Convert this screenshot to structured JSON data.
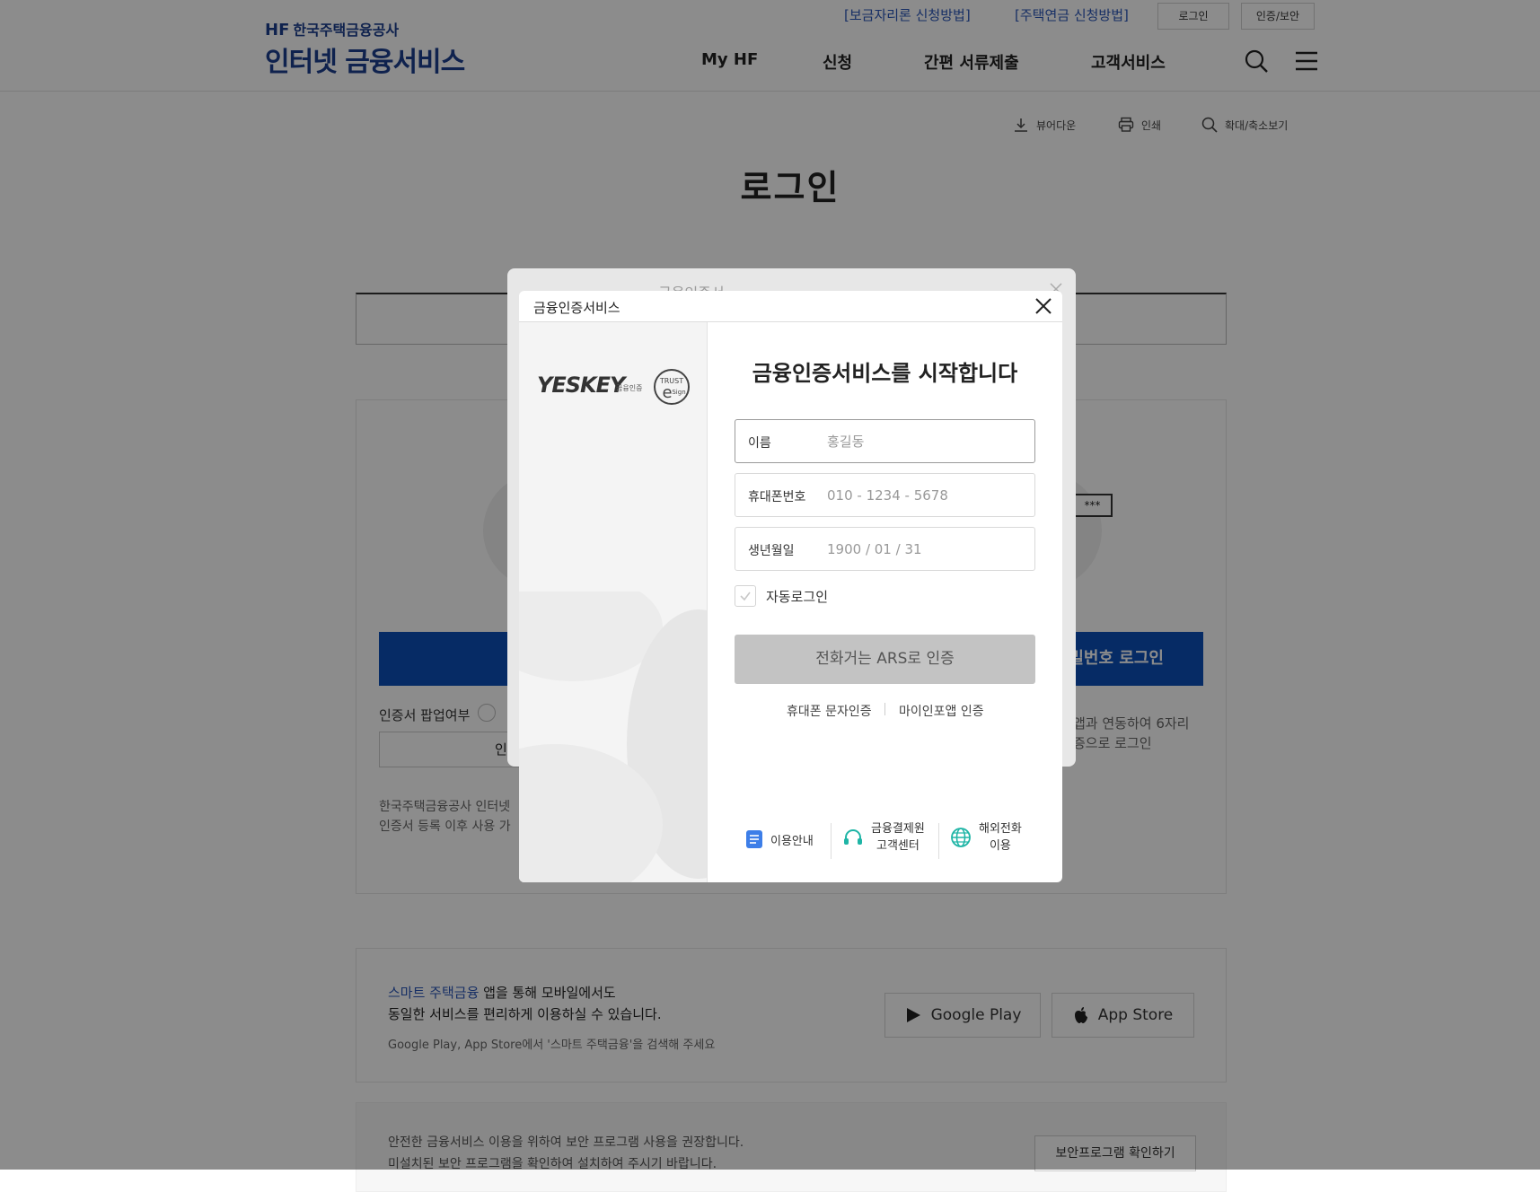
{
  "header": {
    "brand_small_prefix": "HF",
    "brand_small": "한국주택금융공사",
    "brand_main": "인터넷 금융서비스",
    "util_links": [
      "[보금자리론 신청방법]",
      "[주택연금 신청방법]"
    ],
    "util_buttons": [
      "로그인",
      "인증/보안"
    ],
    "gnb": [
      "My HF",
      "신청",
      "간편 서류제출",
      "고객서비스"
    ]
  },
  "tools": {
    "viewer": "뷰어다운",
    "print": "인쇄",
    "zoom": "확대/축소보기"
  },
  "page": {
    "title": "로그인",
    "cert_popup_label": "인증서 팝업여부",
    "cert_btn_partial": "인증",
    "sub_btn_partial": "인",
    "pw_btn_partial": "밀번호 로그인",
    "masked_pin": "***",
    "right_desc1": "앱과 연동하여 6자리",
    "right_desc2": "증으로 로그인",
    "notice1": "한국주택금융공사 인터넷",
    "notice2": "인증서 등록 이후 사용 가"
  },
  "app_promo": {
    "line1_link": "스마트 주택금융",
    "line1_rest": " 앱을 통해 모바일에서도",
    "line2": "동일한 서비스를 편리하게 이용하실 수 있습니다.",
    "line3": "Google Play, App Store에서 '스마트 주택금융'을 검색해 주세요",
    "google_play": "Google Play",
    "app_store": "App Store"
  },
  "security": {
    "line1": "안전한 금융서비스 이용을 위하여 보안 프로그램 사용을 권장합니다.",
    "line2": "미설치된 보안 프로그램을 확인하여 설치하여 주시기 바랍니다.",
    "button": "보안프로그램 확인하기"
  },
  "back_dialog": {
    "title": "금융인증서"
  },
  "modal": {
    "title": "금융인증서비스",
    "logo_text": "YESKEY",
    "logo_sub": "금융인증",
    "heading": "금융인증서비스를 시작합니다",
    "fields": [
      {
        "label": "이름",
        "placeholder": "홍길동"
      },
      {
        "label": "휴대폰번호",
        "placeholder": "010 - 1234 - 5678"
      },
      {
        "label": "생년월일",
        "placeholder": "1900 / 01 / 31"
      }
    ],
    "auto_login": "자동로그인",
    "ars_button": "전화거는 ARS로 인증",
    "alt_links": [
      "휴대폰 문자인증",
      "마이인포앱 인증"
    ],
    "footer": {
      "guide": "이용안내",
      "center_line1": "금융결제원",
      "center_line2": "고객센터",
      "overseas_line1": "해외전화",
      "overseas_line2": "이용"
    }
  }
}
